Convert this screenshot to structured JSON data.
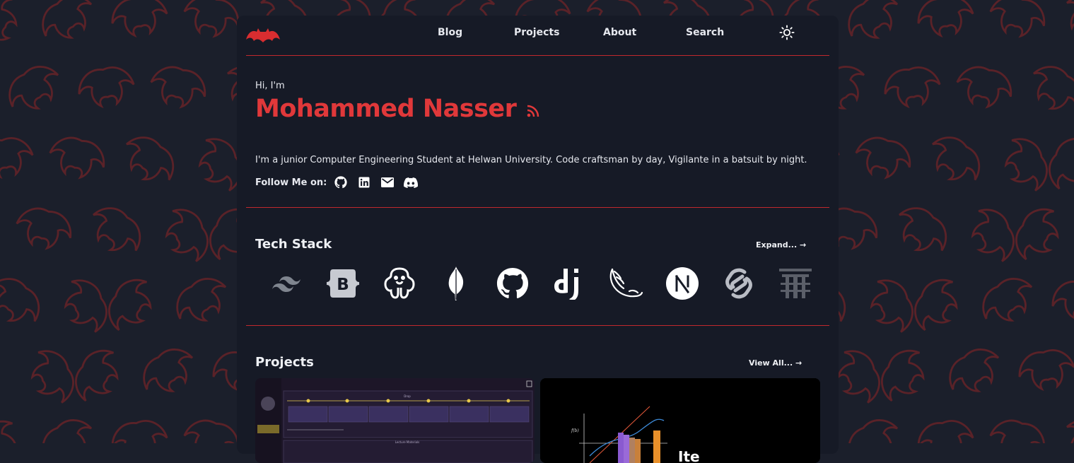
{
  "nav": {
    "links": [
      "Blog",
      "Projects",
      "About",
      "Search"
    ]
  },
  "intro": {
    "greeting": "Hi, I'm",
    "name": "Mohammed Nasser",
    "bio": "I'm a junior Computer Engineering Student at Helwan University. Code craftsman by day, Vigilante in a batsuit by night.",
    "follow_label": "Follow Me on:"
  },
  "tech_stack": {
    "title": "Tech Stack",
    "expand_label": "Expand... →",
    "items": [
      "tailwind-icon",
      "bootstrap-icon",
      "postgresql-icon",
      "mongodb-icon",
      "github-icon",
      "django-icon",
      "flask-icon",
      "nextjs-icon",
      "svelte-icon",
      "tauri-icon"
    ]
  },
  "projects": {
    "title": "Projects",
    "view_all_label": "View All... →",
    "thumb1": {
      "label1": "Drop",
      "label2": "Lecture Materials"
    },
    "thumb2": {
      "label": "f(b)",
      "brand_fragment": "Ite"
    }
  },
  "colors": {
    "accent": "#e0383a",
    "card": "#161a26",
    "background": "#1b1f2b"
  }
}
